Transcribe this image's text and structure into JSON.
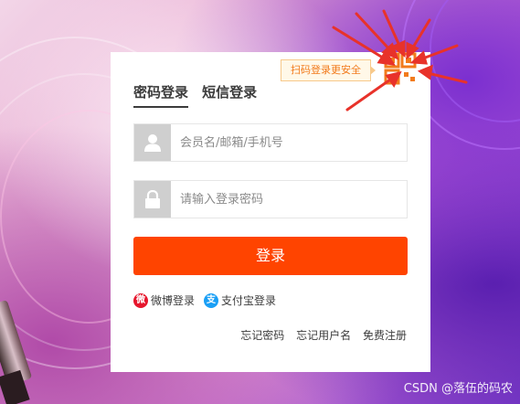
{
  "qr": {
    "tip": "扫码登录更安全"
  },
  "tabs": [
    {
      "label": "密码登录",
      "active": true
    },
    {
      "label": "短信登录",
      "active": false
    }
  ],
  "form": {
    "username_placeholder": "会员名/邮箱/手机号",
    "password_placeholder": "请输入登录密码",
    "username_value": "",
    "password_value": "",
    "submit_label": "登录"
  },
  "third_party": {
    "weibo_label": "微博登录",
    "alipay_label": "支付宝登录"
  },
  "links": {
    "forgot_password": "忘记密码",
    "forgot_username": "忘记用户名",
    "register": "免费注册"
  },
  "watermark": "CSDN @落伍的码农",
  "colors": {
    "accent": "#ff4400",
    "qr_tip_text": "#f27b1c",
    "annotation": "#e8322a"
  },
  "icons": {
    "user": "user-icon",
    "lock": "lock-icon",
    "qr": "qr-code-icon",
    "weibo": "weibo-icon",
    "alipay": "alipay-icon"
  }
}
